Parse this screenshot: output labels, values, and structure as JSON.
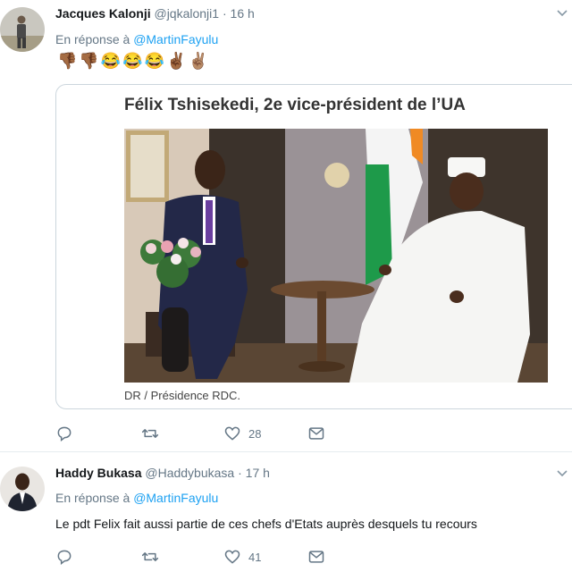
{
  "tweets": [
    {
      "author_name": "Jacques Kalonji",
      "handle": "@jqkalonji1",
      "separator": "·",
      "time": "16 h",
      "reply_prefix": "En réponse à",
      "reply_mention": "@MartinFayulu",
      "emojis": "👎🏾👎🏾😂😂😂✌🏾✌🏽",
      "card": {
        "title": "Félix Tshisekedi, 2e vice-président de l’UA",
        "credit": "DR / Présidence RDC."
      },
      "actions": {
        "reply_icon": "reply-icon",
        "retweet_icon": "retweet-icon",
        "like_icon": "heart-icon",
        "like_count": "28",
        "dm_icon": "mail-icon"
      }
    },
    {
      "author_name": "Haddy Bukasa",
      "handle": "@Haddybukasa",
      "separator": "·",
      "time": "17 h",
      "reply_prefix": "En réponse à",
      "reply_mention": "@MartinFayulu",
      "text": "Le pdt Felix fait aussi partie de ces chefs d'Etats auprès desquels tu recours",
      "actions": {
        "reply_icon": "reply-icon",
        "retweet_icon": "retweet-icon",
        "like_icon": "heart-icon",
        "like_count": "41",
        "dm_icon": "mail-icon"
      }
    }
  ],
  "colors": {
    "link": "#1da1f2",
    "secondary_text": "#657786",
    "border": "#e6ecf0"
  }
}
